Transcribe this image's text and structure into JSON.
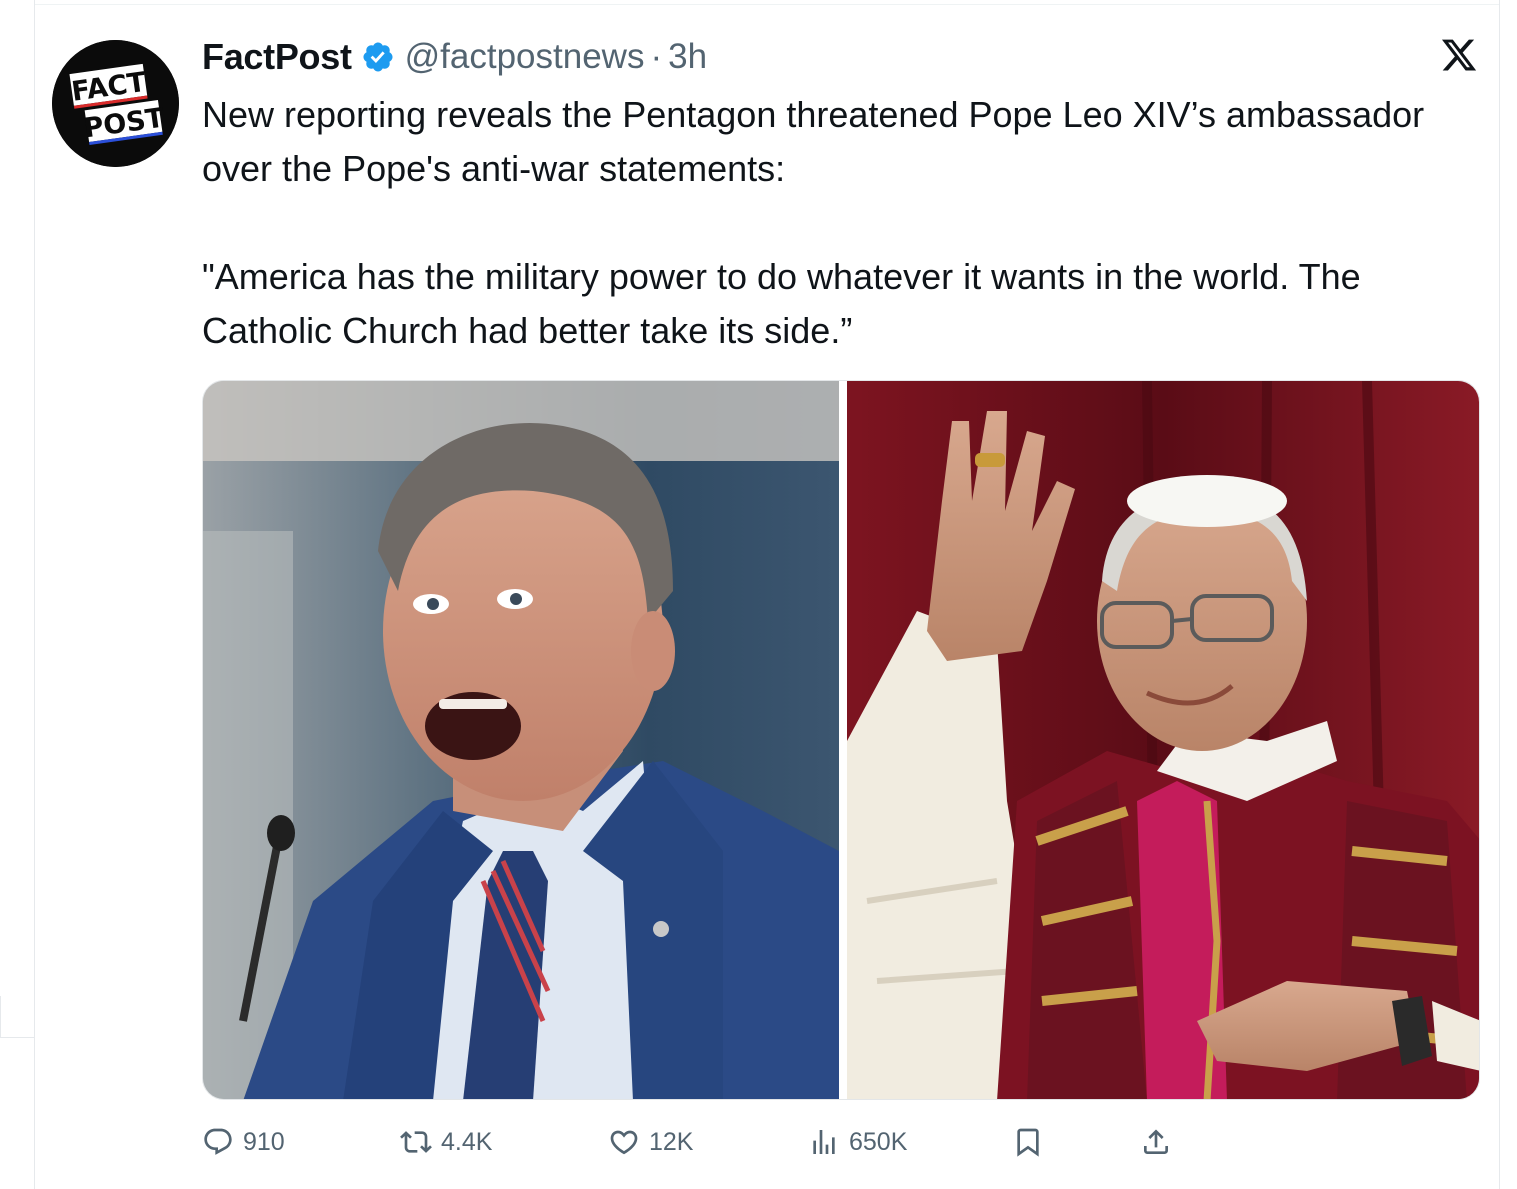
{
  "post": {
    "author": {
      "name": "FactPost",
      "handle": "@factpostnews",
      "separator": "·",
      "time": "3h",
      "avatar_text_line1": "FACT",
      "avatar_text_line2": "POST",
      "verified_icon": "verified-badge-icon"
    },
    "platform_icon": "x-logo-icon",
    "text": {
      "line1": "New reporting reveals the Pentagon threatened Pope Leo XIV’s ambassador over the Pope's anti-war statements:",
      "line2": "\"America has the military power to do whatever it wants in the world. The Catholic Church had better take its side.”"
    },
    "media": [
      {
        "name": "photo-shouting-man-in-suit",
        "icon": "image"
      },
      {
        "name": "photo-pope-waving",
        "icon": "image"
      }
    ],
    "actions": {
      "reply": {
        "icon": "reply-icon",
        "count": "910"
      },
      "repost": {
        "icon": "repost-icon",
        "count": "4.4K"
      },
      "like": {
        "icon": "heart-icon",
        "count": "12K"
      },
      "views": {
        "icon": "views-icon",
        "count": "650K"
      },
      "bookmark": {
        "icon": "bookmark-icon"
      },
      "share": {
        "icon": "share-icon"
      }
    }
  },
  "colors": {
    "text": "#0f1419",
    "muted": "#536471",
    "verified": "#1d9bf0",
    "border": "#e6e9ec"
  }
}
